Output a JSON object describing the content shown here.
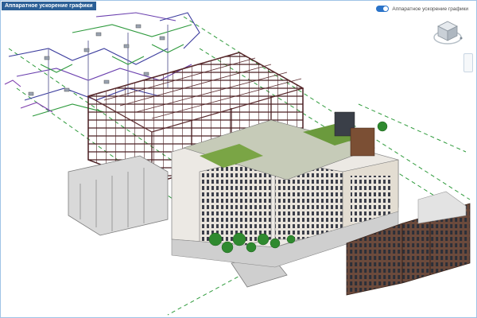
{
  "viewer": {
    "title": "Аппаратное ускорение графики",
    "toggle_label": "Аппаратное ускорение графики",
    "toggle_on": true,
    "accent_color": "#2a73c9",
    "title_bg_color": "#2b5f96",
    "viewcube_icon": "viewcube-icon",
    "nav_icon": "navigation-bar-icon"
  }
}
